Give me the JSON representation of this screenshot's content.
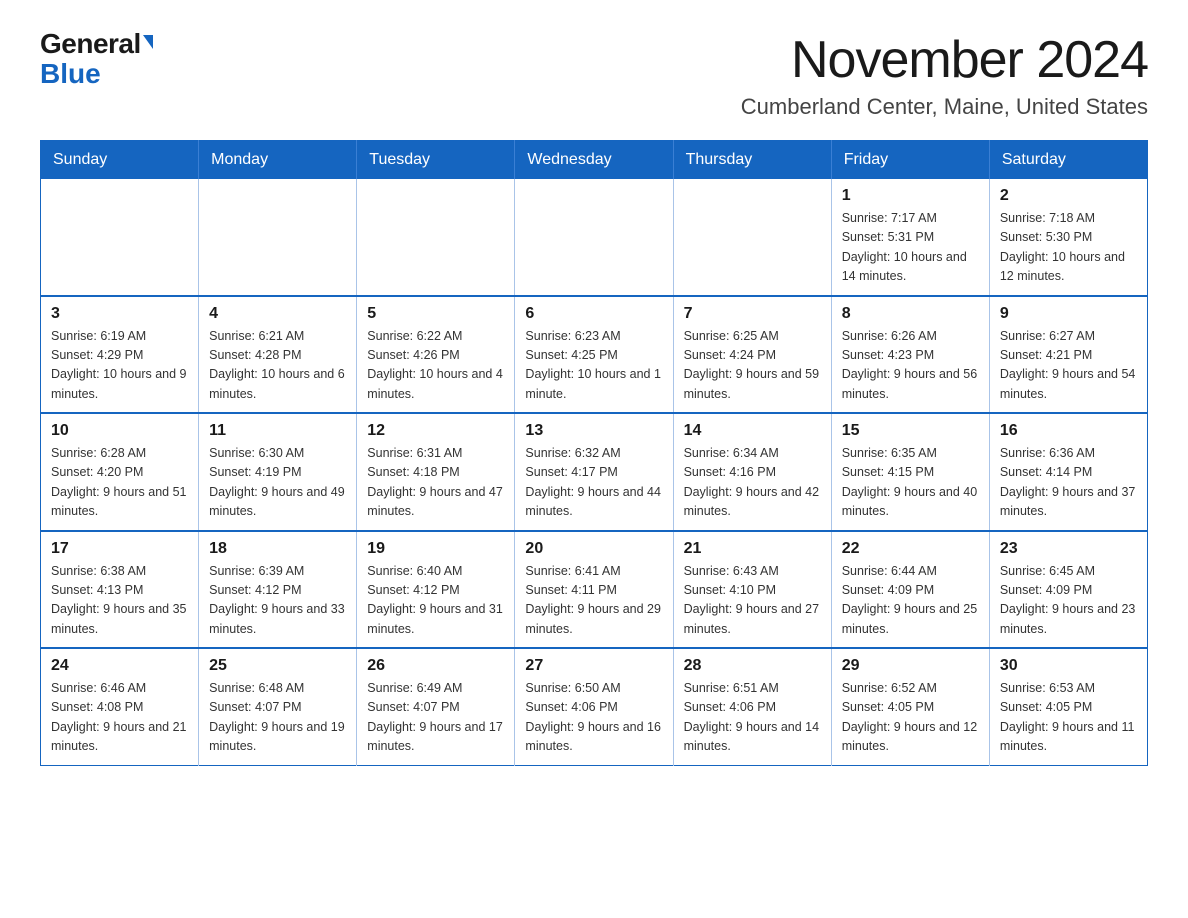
{
  "header": {
    "logo_general": "General",
    "logo_blue": "Blue",
    "month_title": "November 2024",
    "location": "Cumberland Center, Maine, United States"
  },
  "calendar": {
    "weekdays": [
      "Sunday",
      "Monday",
      "Tuesday",
      "Wednesday",
      "Thursday",
      "Friday",
      "Saturday"
    ],
    "rows": [
      [
        {
          "day": "",
          "info": ""
        },
        {
          "day": "",
          "info": ""
        },
        {
          "day": "",
          "info": ""
        },
        {
          "day": "",
          "info": ""
        },
        {
          "day": "",
          "info": ""
        },
        {
          "day": "1",
          "info": "Sunrise: 7:17 AM\nSunset: 5:31 PM\nDaylight: 10 hours and 14 minutes."
        },
        {
          "day": "2",
          "info": "Sunrise: 7:18 AM\nSunset: 5:30 PM\nDaylight: 10 hours and 12 minutes."
        }
      ],
      [
        {
          "day": "3",
          "info": "Sunrise: 6:19 AM\nSunset: 4:29 PM\nDaylight: 10 hours and 9 minutes."
        },
        {
          "day": "4",
          "info": "Sunrise: 6:21 AM\nSunset: 4:28 PM\nDaylight: 10 hours and 6 minutes."
        },
        {
          "day": "5",
          "info": "Sunrise: 6:22 AM\nSunset: 4:26 PM\nDaylight: 10 hours and 4 minutes."
        },
        {
          "day": "6",
          "info": "Sunrise: 6:23 AM\nSunset: 4:25 PM\nDaylight: 10 hours and 1 minute."
        },
        {
          "day": "7",
          "info": "Sunrise: 6:25 AM\nSunset: 4:24 PM\nDaylight: 9 hours and 59 minutes."
        },
        {
          "day": "8",
          "info": "Sunrise: 6:26 AM\nSunset: 4:23 PM\nDaylight: 9 hours and 56 minutes."
        },
        {
          "day": "9",
          "info": "Sunrise: 6:27 AM\nSunset: 4:21 PM\nDaylight: 9 hours and 54 minutes."
        }
      ],
      [
        {
          "day": "10",
          "info": "Sunrise: 6:28 AM\nSunset: 4:20 PM\nDaylight: 9 hours and 51 minutes."
        },
        {
          "day": "11",
          "info": "Sunrise: 6:30 AM\nSunset: 4:19 PM\nDaylight: 9 hours and 49 minutes."
        },
        {
          "day": "12",
          "info": "Sunrise: 6:31 AM\nSunset: 4:18 PM\nDaylight: 9 hours and 47 minutes."
        },
        {
          "day": "13",
          "info": "Sunrise: 6:32 AM\nSunset: 4:17 PM\nDaylight: 9 hours and 44 minutes."
        },
        {
          "day": "14",
          "info": "Sunrise: 6:34 AM\nSunset: 4:16 PM\nDaylight: 9 hours and 42 minutes."
        },
        {
          "day": "15",
          "info": "Sunrise: 6:35 AM\nSunset: 4:15 PM\nDaylight: 9 hours and 40 minutes."
        },
        {
          "day": "16",
          "info": "Sunrise: 6:36 AM\nSunset: 4:14 PM\nDaylight: 9 hours and 37 minutes."
        }
      ],
      [
        {
          "day": "17",
          "info": "Sunrise: 6:38 AM\nSunset: 4:13 PM\nDaylight: 9 hours and 35 minutes."
        },
        {
          "day": "18",
          "info": "Sunrise: 6:39 AM\nSunset: 4:12 PM\nDaylight: 9 hours and 33 minutes."
        },
        {
          "day": "19",
          "info": "Sunrise: 6:40 AM\nSunset: 4:12 PM\nDaylight: 9 hours and 31 minutes."
        },
        {
          "day": "20",
          "info": "Sunrise: 6:41 AM\nSunset: 4:11 PM\nDaylight: 9 hours and 29 minutes."
        },
        {
          "day": "21",
          "info": "Sunrise: 6:43 AM\nSunset: 4:10 PM\nDaylight: 9 hours and 27 minutes."
        },
        {
          "day": "22",
          "info": "Sunrise: 6:44 AM\nSunset: 4:09 PM\nDaylight: 9 hours and 25 minutes."
        },
        {
          "day": "23",
          "info": "Sunrise: 6:45 AM\nSunset: 4:09 PM\nDaylight: 9 hours and 23 minutes."
        }
      ],
      [
        {
          "day": "24",
          "info": "Sunrise: 6:46 AM\nSunset: 4:08 PM\nDaylight: 9 hours and 21 minutes."
        },
        {
          "day": "25",
          "info": "Sunrise: 6:48 AM\nSunset: 4:07 PM\nDaylight: 9 hours and 19 minutes."
        },
        {
          "day": "26",
          "info": "Sunrise: 6:49 AM\nSunset: 4:07 PM\nDaylight: 9 hours and 17 minutes."
        },
        {
          "day": "27",
          "info": "Sunrise: 6:50 AM\nSunset: 4:06 PM\nDaylight: 9 hours and 16 minutes."
        },
        {
          "day": "28",
          "info": "Sunrise: 6:51 AM\nSunset: 4:06 PM\nDaylight: 9 hours and 14 minutes."
        },
        {
          "day": "29",
          "info": "Sunrise: 6:52 AM\nSunset: 4:05 PM\nDaylight: 9 hours and 12 minutes."
        },
        {
          "day": "30",
          "info": "Sunrise: 6:53 AM\nSunset: 4:05 PM\nDaylight: 9 hours and 11 minutes."
        }
      ]
    ]
  }
}
